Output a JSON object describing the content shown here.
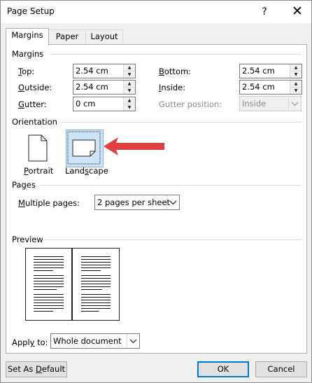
{
  "window": {
    "title": "Page Setup",
    "help_glyph": "?",
    "close_glyph": "✕"
  },
  "tabs": [
    {
      "label": "Margins",
      "active": true
    },
    {
      "label": "Paper",
      "active": false
    },
    {
      "label": "Layout",
      "active": false
    }
  ],
  "margins": {
    "group_label": "Margins",
    "top": {
      "key": "T",
      "rest": "op:",
      "value": "2.54 cm"
    },
    "outside": {
      "key": "O",
      "rest": "utside:",
      "value": "2.54 cm"
    },
    "gutter": {
      "key": "G",
      "rest": "utter:",
      "value": "0 cm"
    },
    "bottom": {
      "key": "B",
      "rest": "ottom:",
      "value": "2.54 cm"
    },
    "inside": {
      "key": "I",
      "rest": "nside:",
      "value": "2.54 cm"
    },
    "gutter_position": {
      "label": "Gutter position:",
      "value": "Inside"
    }
  },
  "orientation": {
    "group_label": "Orientation",
    "portrait": {
      "key": "P",
      "rest": "ortrait"
    },
    "landscape": {
      "pre": "Land",
      "key": "s",
      "rest": "cape"
    },
    "arrow_color": "#e0403f"
  },
  "pages": {
    "group_label": "Pages",
    "multiple_pages": {
      "key": "M",
      "rest": "ultiple pages:",
      "value": "2 pages per sheet"
    }
  },
  "preview": {
    "group_label": "Preview"
  },
  "apply_to": {
    "label": "Apply to:",
    "key_pre": "Appl",
    "key": "y",
    "rest": " to:",
    "value": "Whole document"
  },
  "buttons": {
    "set_default": {
      "pre": "Set As ",
      "key": "D",
      "rest": "efault"
    },
    "ok": "OK",
    "cancel": "Cancel"
  },
  "colors": {
    "accent": "#0078d7",
    "selection": "#cce4f7"
  }
}
